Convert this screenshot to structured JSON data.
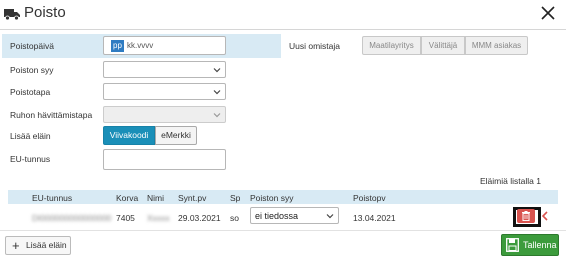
{
  "dialog": {
    "title": "Poisto",
    "truck_icon": "truck-icon",
    "close_icon": "close-icon"
  },
  "form": {
    "poistopaiva_label": "Poistopäivä",
    "date_pp": "pp",
    "date_rest": "kk.vvvv",
    "poiston_syy_label": "Poiston syy",
    "poistotapa_label": "Poistotapa",
    "ruhon_label": "Ruhon hävittämistapa",
    "lisaa_elain_label": "Lisää eläin",
    "viivakoodi": "Viivakoodi",
    "emerkki": "eMerkki",
    "eu_tunnus_label": "EU-tunnus"
  },
  "uusi": {
    "label": "Uusi omistaja",
    "buttons": [
      "Maatilayritys",
      "Välittäjä",
      "MMM asiakas"
    ]
  },
  "table": {
    "count_text": "Eläimiä listalla 1",
    "headers": [
      "EU-tunnus",
      "Korva",
      "Nimi",
      "Synt.pv",
      "Sp",
      "Poiston syy",
      "Poistopv"
    ],
    "row": {
      "eu_tunnus": "DI000000000000000",
      "korva": "7405",
      "nimi": "Xxxxx",
      "synt": "29.03.2021",
      "sp": "so",
      "poiston_syy": "ei tiedossa",
      "poistopv": "13.04.2021"
    }
  },
  "footer": {
    "add_label": "Lisää eläin",
    "save_label": "Tallenna"
  },
  "colors": {
    "accent": "#1a8fb8",
    "save": "#3c9b3c",
    "delete": "#d9534f",
    "highlight": "#d8eaf4"
  }
}
